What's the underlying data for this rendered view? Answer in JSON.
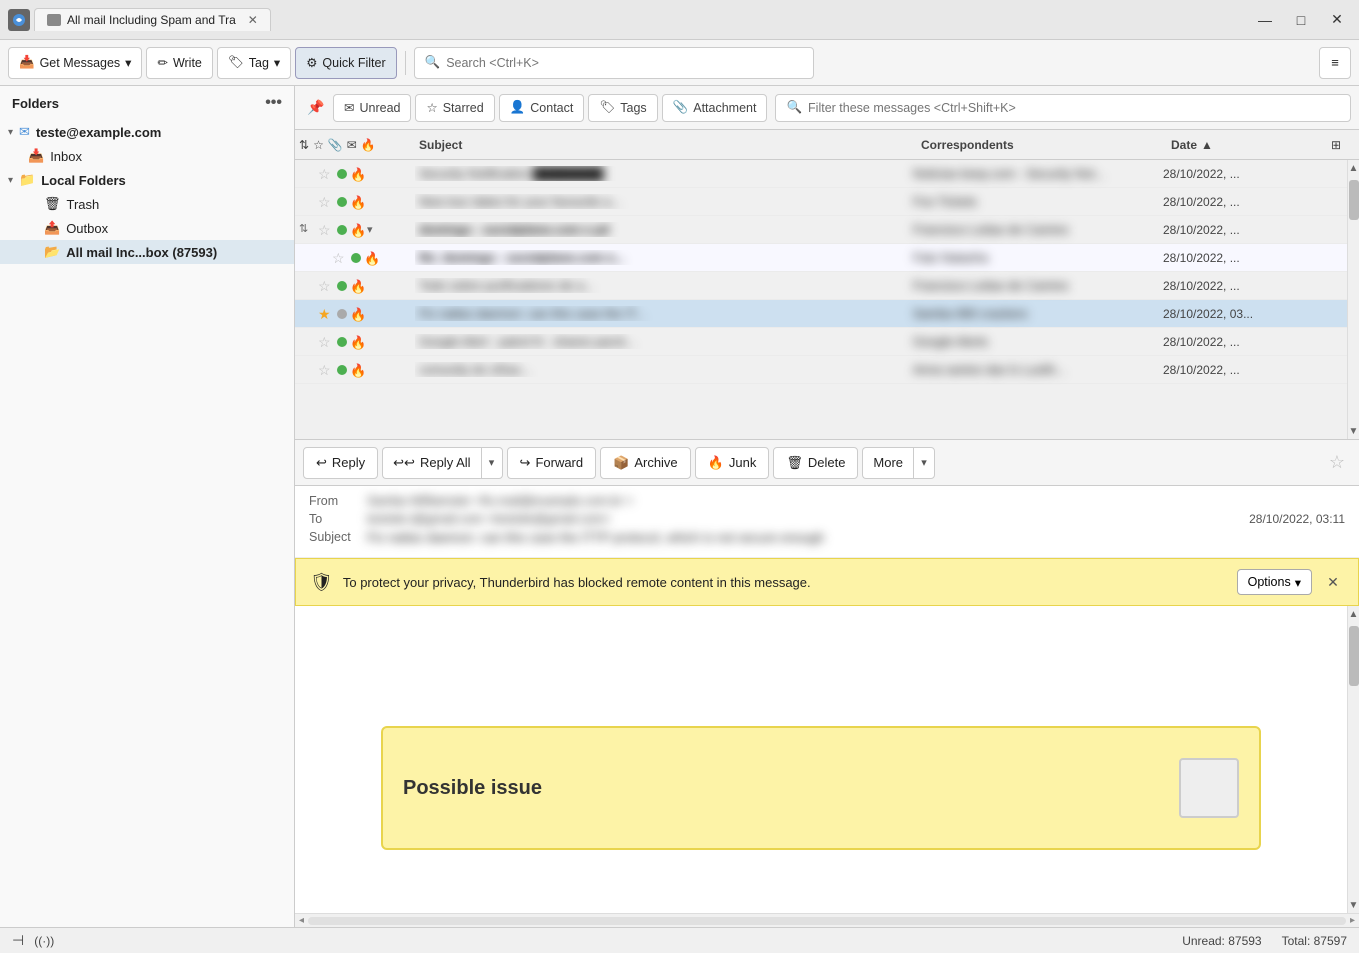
{
  "titlebar": {
    "tab_title": "All mail Including Spam and Tra",
    "app_icon": "☰",
    "minimize": "—",
    "maximize": "□",
    "close": "✕"
  },
  "toolbar": {
    "get_messages": "Get Messages",
    "write": "Write",
    "tag": "Tag",
    "quick_filter": "Quick Filter",
    "search_placeholder": "Search <Ctrl+K>",
    "menu": "≡"
  },
  "filter_bar": {
    "unread": "Unread",
    "starred": "Starred",
    "contact": "Contact",
    "tags": "Tags",
    "attachment": "Attachment",
    "filter_placeholder": "Filter these messages <Ctrl+Shift+K>"
  },
  "sidebar": {
    "folders_label": "Folders",
    "account": "teste@example.com",
    "inbox": "Inbox",
    "local_folders": "Local Folders",
    "trash": "Trash",
    "outbox": "Outbox",
    "all_mail": "All mail Inc...box (87593)"
  },
  "email_list": {
    "col_subject": "Subject",
    "col_correspondents": "Correspondents",
    "col_date": "Date",
    "rows": [
      {
        "id": 1,
        "starred": false,
        "read": true,
        "subject": "Security Notification",
        "correspondents": "Noticias keep.com - Security Not...",
        "date": "28/10/2022, ...",
        "dot": "green",
        "unread": false
      },
      {
        "id": 2,
        "starred": false,
        "read": true,
        "subject": "New tour dates for your favourite a...",
        "correspondents": "Foo Tickets",
        "date": "28/10/2022, ...",
        "dot": "green",
        "unread": false
      },
      {
        "id": 3,
        "starred": false,
        "read": false,
        "subject": "domingo - socialplane.com e pd",
        "correspondents": "Francisco Leitao de Camino",
        "date": "28/10/2022, ...",
        "dot": "green",
        "unread": true,
        "thread": true,
        "expanded": true
      },
      {
        "id": 4,
        "starred": false,
        "read": false,
        "subject": "Re: domingo - socialplane.com e...",
        "correspondents": "Fato Natasha",
        "date": "28/10/2022, ...",
        "dot": "green",
        "unread": true,
        "indent": true
      },
      {
        "id": 5,
        "starred": false,
        "read": false,
        "subject": "Todo sobre purificadores de a...",
        "correspondents": "Francisco Leitao de Camino",
        "date": "28/10/2022, ...",
        "dot": "green",
        "unread": false
      },
      {
        "id": 6,
        "starred": true,
        "read": true,
        "subject": "Fix natlas daemon: can this case the IT...",
        "correspondents": "Samba 990 crackers",
        "date": "28/10/2022, 03...",
        "dot": "gray",
        "unread": false,
        "selected": true
      },
      {
        "id": 7,
        "starred": false,
        "read": true,
        "subject": "Google Alert - patrol N - shares parck...",
        "correspondents": "Google Alerts",
        "date": "28/10/2022, ...",
        "dot": "green",
        "unread": false
      },
      {
        "id": 8,
        "starred": false,
        "read": true,
        "subject": "comunity do cifrao...",
        "correspondents": "Anna santos das ls Lusith...",
        "date": "28/10/2022, ...",
        "dot": "green",
        "unread": false
      }
    ]
  },
  "action_bar": {
    "reply": "Reply",
    "reply_all": "Reply All",
    "forward": "Forward",
    "archive": "Archive",
    "junk": "Junk",
    "delete": "Delete",
    "more": "More"
  },
  "message_header": {
    "from_label": "From",
    "from_value": "Samba Williamster <fix.mail@example.com.br >",
    "to_label": "To",
    "to_value": "testsite.t@gmail.com <testsite@gmail.com>",
    "date_value": "28/10/2022, 03:11",
    "subject_label": "Subject",
    "subject_value": "Fix natlas daemon: can this case the ITTP protocol, which is not secure enough"
  },
  "privacy_banner": {
    "icon": "🛡",
    "text": "To protect your privacy, Thunderbird has blocked remote content in this message.",
    "options_btn": "Options",
    "close": "✕"
  },
  "message_body": {
    "possible_issue_text": "Possible issue"
  },
  "statusbar": {
    "layout_icon": "⊣",
    "audio_icon": "((·))",
    "unread_label": "Unread: 87593",
    "total_label": "Total: 87597"
  }
}
